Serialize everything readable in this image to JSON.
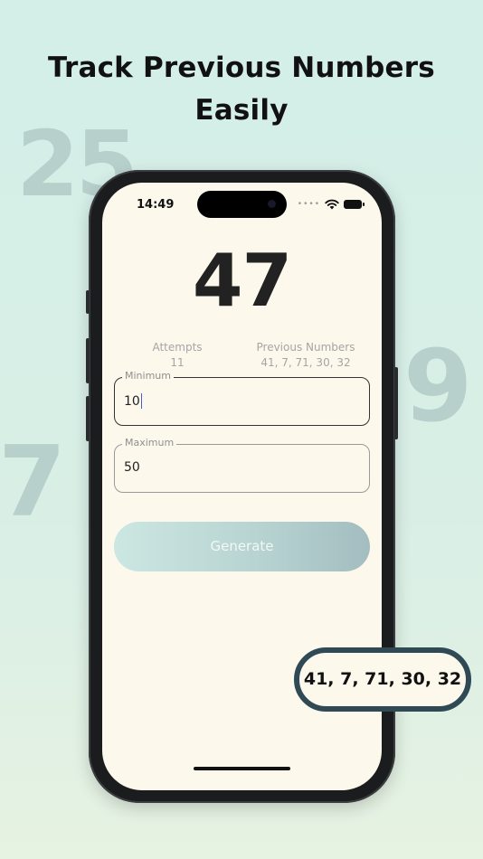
{
  "headline": {
    "line1": "Track Previous Numbers",
    "line2": "Easily"
  },
  "background_numbers": [
    "25",
    "9",
    "7"
  ],
  "status_bar": {
    "time": "14:49",
    "signal": "••••",
    "icons": [
      "wifi-icon",
      "battery-icon"
    ]
  },
  "app": {
    "current_number": "47",
    "attempts_label": "Attempts",
    "attempts_value": "11",
    "previous_label": "Previous Numbers",
    "previous_value": "41, 7, 71, 30, 32",
    "minimum": {
      "label": "Minimum",
      "value": "10"
    },
    "maximum": {
      "label": "Maximum",
      "value": "50"
    },
    "generate_label": "Generate"
  },
  "callout": {
    "text": "41, 7, 71, 30, 32"
  },
  "colors": {
    "background": "#d3efe8",
    "screen": "#fdf8ec",
    "badge_border": "#2f4a55",
    "caret": "#4a5bd8"
  }
}
